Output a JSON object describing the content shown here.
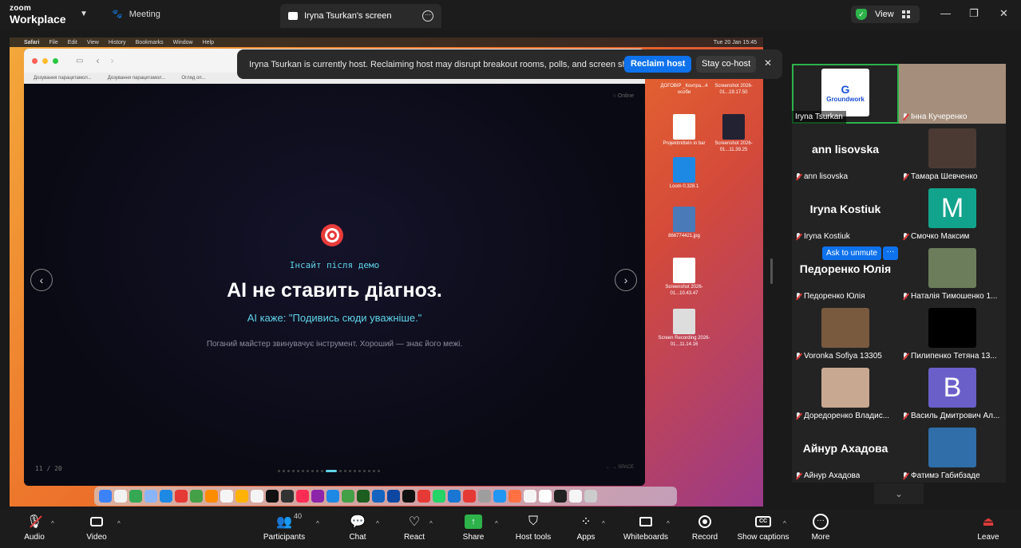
{
  "app": {
    "brand_line1": "zoom",
    "brand_line2": "Workplace"
  },
  "tabs": {
    "meeting": "Meeting",
    "screen": "Iryna Tsurkan's screen"
  },
  "view": {
    "label": "View"
  },
  "window": {
    "minimize": "—",
    "restore": "❐",
    "close": "✕"
  },
  "mac_menubar": {
    "items": [
      "Safari",
      "File",
      "Edit",
      "View",
      "History",
      "Bookmarks",
      "Window",
      "Help"
    ],
    "clock": "Tue 20 Jan  15:45"
  },
  "safari": {
    "bookmarks": [
      "Дозування парацетамол...",
      "Дозування парацетамол...",
      "Огляд оп..."
    ]
  },
  "slide": {
    "kicker": "Інсайт після демо",
    "title": "AI не ставить діагноз.",
    "subtitle": "AI каже: \"Подивись сюди уважніше.\"",
    "note": "Поганий майстер звинувачує інструмент. Хороший — знає його межі.",
    "page": "11 / 20",
    "status": "○ Online",
    "space_hint": "← → SPACE",
    "current_index": 11,
    "total": 20
  },
  "desktop_icons": [
    {
      "label": "ДОГОВІР _Контра...4 особи"
    },
    {
      "label": "Screenshot 2026-01...19.17.50"
    },
    {
      "label": "Projektmitteln in bar"
    },
    {
      "label": "Screenshot 2026-01...11.39.25"
    },
    {
      "label": "Loom 0.328.1"
    },
    {
      "label": "866774421.jpg"
    },
    {
      "label": "Screenshot 2026-01...10.43.47"
    },
    {
      "label": "Screen Recording 2026-01...11.14.16"
    }
  ],
  "banner": {
    "message": "Iryna Tsurkan is currently host. Reclaiming host may disrupt breakout rooms, polls, and screen share",
    "reclaim": "Reclaim host",
    "stay": "Stay co-host",
    "close": "✕"
  },
  "participants_panel": {
    "tiles": [
      {
        "name": "Iryna Tsurkan",
        "muted": false,
        "kind": "logo",
        "logo_text": "Groundwork",
        "logo_mark": "G"
      },
      {
        "name": "Інна Кучеренко",
        "muted": true,
        "kind": "photo",
        "color": "#a58f7c"
      },
      {
        "name": "ann lisovska",
        "muted": true,
        "kind": "text",
        "big": "ann lisovska"
      },
      {
        "name": "Тамара Шевченко",
        "muted": true,
        "kind": "photo",
        "color": "#4b3a33"
      },
      {
        "name": "Iryna Kostiuk",
        "muted": true,
        "kind": "text",
        "big": "Iryna Kostiuk"
      },
      {
        "name": "Смочко Максим",
        "muted": true,
        "kind": "letter",
        "letter": "M",
        "color": "#12a38c"
      },
      {
        "name": "Педоренко Юлія",
        "muted": true,
        "kind": "text",
        "big": "Педоренко Юлія"
      },
      {
        "name": "Наталія Тимошенко 1...",
        "muted": true,
        "kind": "photo",
        "color": "#6b7d5a"
      },
      {
        "name": "Voronka Sofiya 13305",
        "muted": true,
        "kind": "photo",
        "color": "#7a5a3e"
      },
      {
        "name": "Пилипенко Тетяна 13...",
        "muted": true,
        "kind": "photo",
        "color": "#000000"
      },
      {
        "name": "Доредоренко Владис...",
        "muted": true,
        "kind": "photo",
        "color": "#c9a892"
      },
      {
        "name": "Василь Дмитрович Ал...",
        "muted": true,
        "kind": "letter",
        "letter": "B",
        "color": "#6a5fc9"
      },
      {
        "name": "Айнур Ахадова",
        "muted": true,
        "kind": "text",
        "big": "Айнур Ахадова"
      },
      {
        "name": "Фатимэ Габибзаде",
        "muted": true,
        "kind": "photo",
        "color": "#2f6ea8"
      }
    ],
    "ask_to_unmute": "Ask to unmute",
    "more": "···"
  },
  "toolbar": {
    "audio": "Audio",
    "video": "Video",
    "participants": "Participants",
    "participant_count": "40",
    "chat": "Chat",
    "react": "React",
    "share": "Share",
    "host_tools": "Host tools",
    "apps": "Apps",
    "whiteboards": "Whiteboards",
    "record": "Record",
    "captions": "Show captions",
    "more": "More",
    "leave": "Leave"
  },
  "colors": {
    "accent": "#0e72ed",
    "active_speaker": "#2db34a",
    "mute_red": "#e03b3b",
    "slide_cyan": "#5fd3e8"
  }
}
